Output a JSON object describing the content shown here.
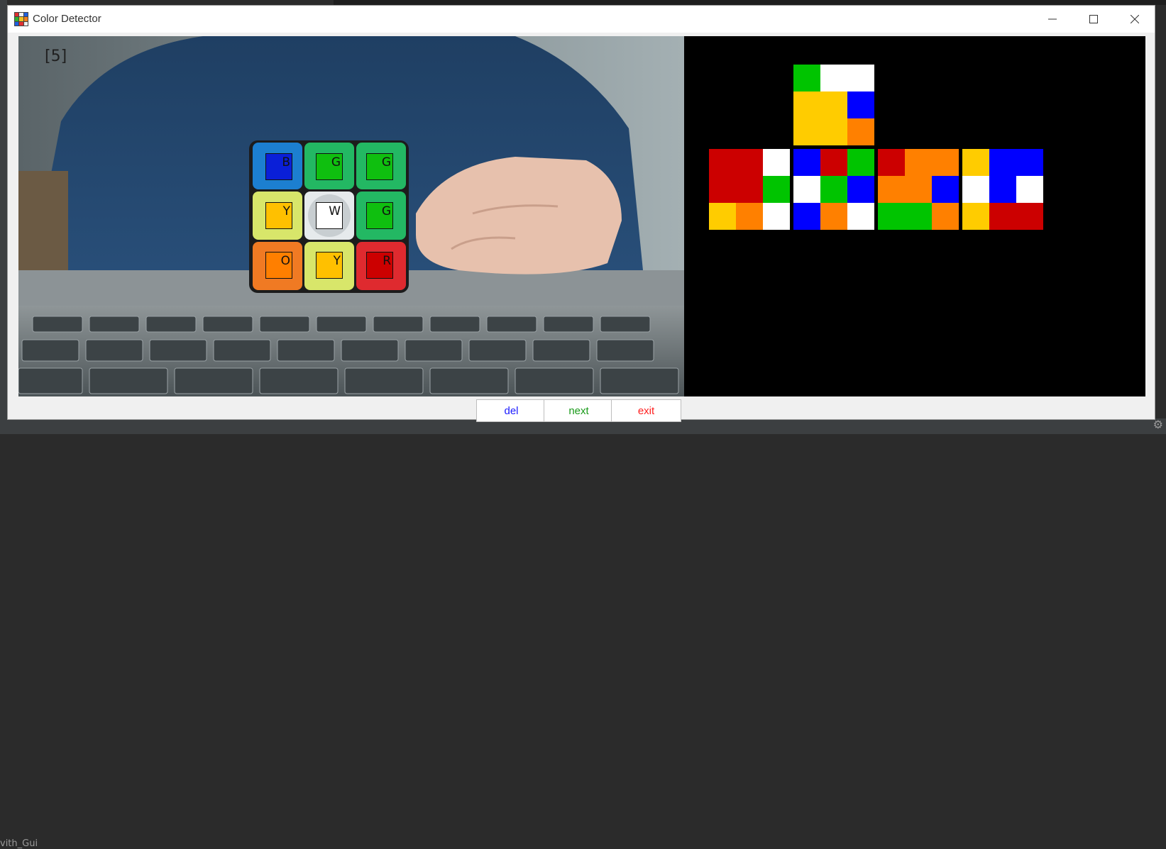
{
  "window": {
    "title": "Color Detector"
  },
  "desktop": {
    "bottom_text": "vith_Gui"
  },
  "camera": {
    "counter_text": "[5]",
    "detected": [
      [
        "B",
        "G",
        "G"
      ],
      [
        "Y",
        "W",
        "G"
      ],
      [
        "O",
        "Y",
        "R"
      ]
    ],
    "detected_colors": [
      [
        "#0a1fd8",
        "#0fbf0f",
        "#0fbf0f"
      ],
      [
        "#ffc000",
        "#ffffff",
        "#0fbf0f"
      ],
      [
        "#ff7f00",
        "#ffc000",
        "#cc0000"
      ]
    ]
  },
  "colors": {
    "W": "#ffffff",
    "G": "#00c400",
    "B": "#0000ff",
    "Y": "#ffcc00",
    "O": "#ff8000",
    "R": "#cc0000"
  },
  "net": {
    "up": [
      [
        "G",
        "W",
        "W"
      ],
      [
        "Y",
        "Y",
        "B"
      ],
      [
        "Y",
        "Y",
        "O"
      ]
    ],
    "left": [
      [
        "R",
        "R",
        "W"
      ],
      [
        "R",
        "R",
        "G"
      ],
      [
        "Y",
        "O",
        "W"
      ]
    ],
    "front": [
      [
        "B",
        "R",
        "G"
      ],
      [
        "W",
        "G",
        "B"
      ],
      [
        "B",
        "O",
        "W"
      ]
    ],
    "right": [
      [
        "R",
        "O",
        "O"
      ],
      [
        "O",
        "O",
        "B"
      ],
      [
        "G",
        "G",
        "O"
      ]
    ],
    "back": [
      [
        "Y",
        "B",
        "B"
      ],
      [
        "W",
        "B",
        "W"
      ],
      [
        "Y",
        "R",
        "R"
      ]
    ]
  },
  "buttons": [
    {
      "label": "del",
      "color": "#1a1aff"
    },
    {
      "label": "next",
      "color": "#1a9a1a"
    },
    {
      "label": "exit",
      "color": "#ff2020"
    }
  ]
}
